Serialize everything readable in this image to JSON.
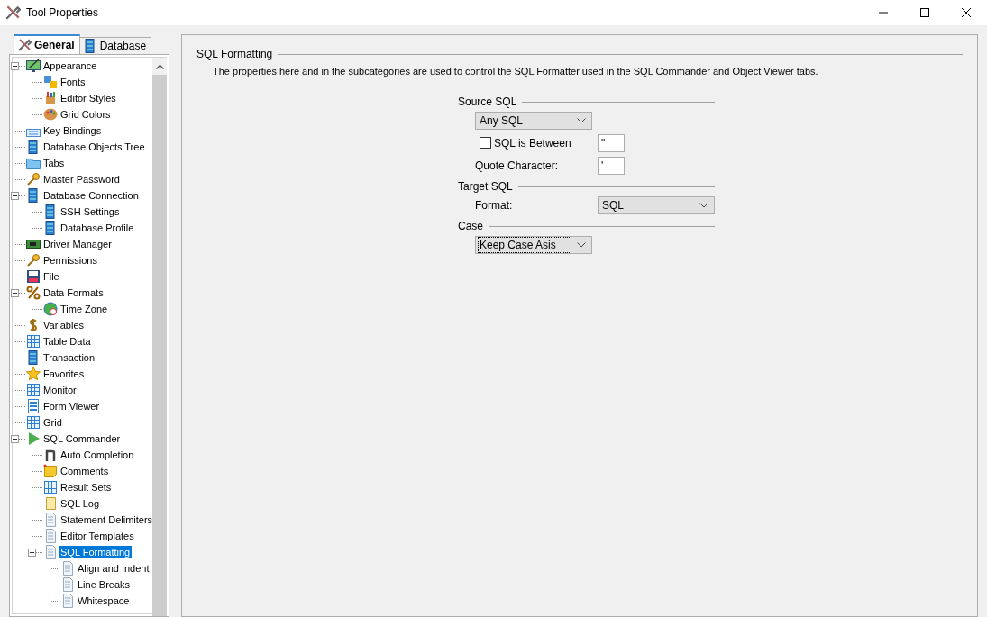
{
  "window": {
    "title": "Tool Properties"
  },
  "tabs": [
    {
      "label": "General",
      "selected": true
    },
    {
      "label": "Database",
      "selected": false
    }
  ],
  "tree": [
    {
      "label": "Appearance",
      "selected": false,
      "expanded": true,
      "children": [
        {
          "label": "Fonts",
          "selected": false
        },
        {
          "label": "Editor Styles",
          "selected": false
        },
        {
          "label": "Grid Colors",
          "selected": false
        }
      ]
    },
    {
      "label": "Key Bindings",
      "selected": false
    },
    {
      "label": "Database Objects Tree",
      "selected": false
    },
    {
      "label": "Tabs",
      "selected": false
    },
    {
      "label": "Master Password",
      "selected": false
    },
    {
      "label": "Database Connection",
      "selected": false,
      "expanded": true,
      "children": [
        {
          "label": "SSH Settings",
          "selected": false
        },
        {
          "label": "Database Profile",
          "selected": false
        }
      ]
    },
    {
      "label": "Driver Manager",
      "selected": false
    },
    {
      "label": "Permissions",
      "selected": false
    },
    {
      "label": "File",
      "selected": false
    },
    {
      "label": "Data Formats",
      "selected": false,
      "expanded": true,
      "children": [
        {
          "label": "Time Zone",
          "selected": false
        }
      ]
    },
    {
      "label": "Variables",
      "selected": false
    },
    {
      "label": "Table Data",
      "selected": false
    },
    {
      "label": "Transaction",
      "selected": false
    },
    {
      "label": "Favorites",
      "selected": false
    },
    {
      "label": "Monitor",
      "selected": false
    },
    {
      "label": "Form Viewer",
      "selected": false
    },
    {
      "label": "Grid",
      "selected": false
    },
    {
      "label": "SQL Commander",
      "selected": false,
      "expanded": true,
      "children": [
        {
          "label": "Auto Completion",
          "selected": false
        },
        {
          "label": "Comments",
          "selected": false
        },
        {
          "label": "Result Sets",
          "selected": false
        },
        {
          "label": "SQL Log",
          "selected": false
        },
        {
          "label": "Statement Delimiters",
          "selected": false
        },
        {
          "label": "Editor Templates",
          "selected": false
        },
        {
          "label": "SQL Formatting",
          "selected": true,
          "expanded": true,
          "children": [
            {
              "label": "Align and Indent",
              "selected": false
            },
            {
              "label": "Line Breaks",
              "selected": false
            },
            {
              "label": "Whitespace",
              "selected": false
            }
          ]
        }
      ]
    }
  ],
  "section": {
    "title": "SQL Formatting",
    "description": "The properties here and in the subcategories are used to control the SQL Formatter used in the SQL Commander and Object Viewer tabs."
  },
  "groups": [
    {
      "title": "Source SQL",
      "fields": [
        {
          "kind": "dropdown",
          "value": "Any SQL",
          "focused": false
        },
        {
          "kind": "checkbox",
          "label": "SQL is Between",
          "checked": false,
          "value": "\""
        },
        {
          "kind": "text",
          "label": "Quote Character:",
          "value": "'"
        }
      ]
    },
    {
      "title": "Target SQL",
      "fields": [
        {
          "kind": "dropdown",
          "label": "Format:",
          "value": "SQL",
          "focused": false
        }
      ]
    },
    {
      "title": "Case",
      "fields": [
        {
          "kind": "dropdown",
          "value": "Keep Case Asis",
          "focused": true
        }
      ]
    }
  ]
}
